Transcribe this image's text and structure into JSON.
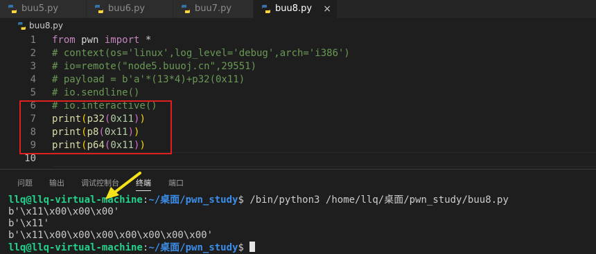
{
  "tabs": [
    {
      "label": "buu5.py",
      "active": false
    },
    {
      "label": "buu6.py",
      "active": false
    },
    {
      "label": "buu7.py",
      "active": false
    },
    {
      "label": "buu8.py",
      "active": true
    }
  ],
  "tab_close_glyph": "×",
  "breadcrumb": "buu8.py",
  "editor": {
    "line_numbers": [
      "1",
      "2",
      "3",
      "4",
      "5",
      "6",
      "7",
      "8",
      "9",
      "10"
    ],
    "lines": {
      "l1_kw_from": "from",
      "l1_mod": " pwn ",
      "l1_kw_import": "import",
      "l1_star": " *",
      "l2": "# context(os='linux',log_level='debug',arch='i386')",
      "l3": "# io=remote(\"node5.buuoj.cn\",29551)",
      "l4": "# payload = b'a'*(13*4)+p32(0x11)",
      "l5": "# io.sendline()",
      "l6": "# io.interactive()",
      "l7_fn": "print",
      "l7_p1": "(",
      "l7_fn2": "p32",
      "l7_p2": "(",
      "l7_num": "0x11",
      "l7_c2": ")",
      "l7_c1": ")",
      "l8_fn": "print",
      "l8_p1": "(",
      "l8_fn2": "p8",
      "l8_p2": "(",
      "l8_num": "0x11",
      "l8_c2": ")",
      "l8_c1": ")",
      "l9_fn": "print",
      "l9_p1": "(",
      "l9_fn2": "p64",
      "l9_p2": "(",
      "l9_num": "0x11",
      "l9_c2": ")",
      "l9_c1": ")"
    }
  },
  "panel_tabs": [
    "问题",
    "输出",
    "调试控制台",
    "终端",
    "端口"
  ],
  "terminal": {
    "user": "llq@llq-virtual-machine",
    "colon": ":",
    "path": "~/桌面/pwn_study",
    "prompt": "$ ",
    "command": "/bin/python3 /home/llq/桌面/pwn_study/buu8.py",
    "output": [
      "b'\\x11\\x00\\x00\\x00'",
      "b'\\x11'",
      "b'\\x11\\x00\\x00\\x00\\x00\\x00\\x00\\x00'"
    ]
  },
  "colors": {
    "accent_red": "#e0201f",
    "arrow_yellow": "#f5e21a",
    "user_green": "#23d18b",
    "path_blue": "#3b8eea"
  },
  "icons": [
    "python-file-icon",
    "close-icon",
    "arrow-annotation"
  ]
}
